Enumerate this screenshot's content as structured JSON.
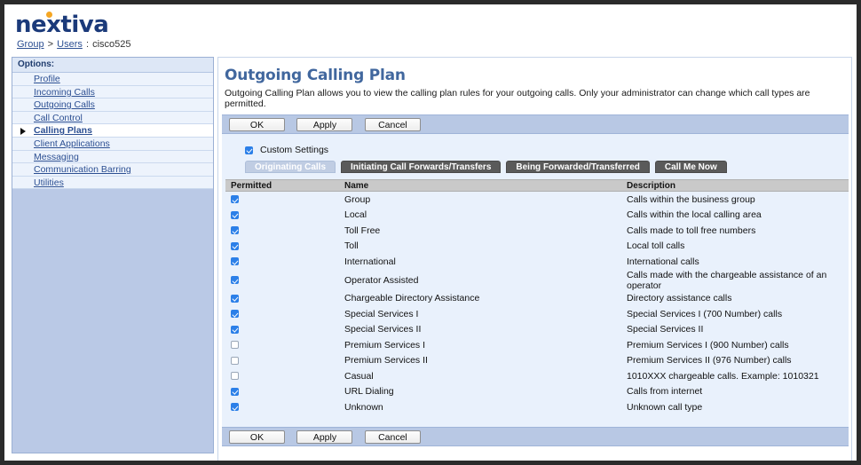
{
  "brand": {
    "logo_text": "nextiva",
    "logo_color": "#1b3a7a",
    "logo_dot_color": "#f5a623"
  },
  "breadcrumb": {
    "group_label": "Group",
    "separator": ">",
    "users_label": "Users",
    "colon": ":",
    "current": "cisco525"
  },
  "sidebar": {
    "heading": "Options:",
    "items": [
      {
        "label": "Profile",
        "active": false
      },
      {
        "label": "Incoming Calls",
        "active": false
      },
      {
        "label": "Outgoing Calls",
        "active": false
      },
      {
        "label": "Call Control",
        "active": false
      },
      {
        "label": "Calling Plans",
        "active": true
      },
      {
        "label": "Client Applications",
        "active": false
      },
      {
        "label": "Messaging",
        "active": false
      },
      {
        "label": "Communication Barring",
        "active": false
      },
      {
        "label": "Utilities",
        "active": false
      }
    ]
  },
  "main": {
    "title": "Outgoing Calling Plan",
    "description": "Outgoing Calling Plan allows you to view the calling plan rules for your outgoing calls. Only your administrator can change which call types are permitted.",
    "buttons": {
      "ok": "OK",
      "apply": "Apply",
      "cancel": "Cancel"
    },
    "custom_settings": {
      "label": "Custom Settings",
      "checked": true
    },
    "tabs": [
      {
        "label": "Originating Calls",
        "active": true
      },
      {
        "label": "Initiating Call Forwards/Transfers",
        "active": false
      },
      {
        "label": "Being Forwarded/Transferred",
        "active": false
      },
      {
        "label": "Call Me Now",
        "active": false
      }
    ],
    "table": {
      "columns": [
        "Permitted",
        "Name",
        "Description"
      ],
      "rows": [
        {
          "permitted": true,
          "name": "Group",
          "description": "Calls within the business group"
        },
        {
          "permitted": true,
          "name": "Local",
          "description": "Calls within the local calling area"
        },
        {
          "permitted": true,
          "name": "Toll Free",
          "description": "Calls made to toll free numbers"
        },
        {
          "permitted": true,
          "name": "Toll",
          "description": "Local toll calls"
        },
        {
          "permitted": true,
          "name": "International",
          "description": "International calls"
        },
        {
          "permitted": true,
          "name": "Operator Assisted",
          "description": "Calls made with the chargeable assistance of an operator"
        },
        {
          "permitted": true,
          "name": "Chargeable Directory Assistance",
          "description": "Directory assistance calls"
        },
        {
          "permitted": true,
          "name": "Special Services I",
          "description": "Special Services I (700 Number) calls"
        },
        {
          "permitted": true,
          "name": "Special Services II",
          "description": "Special Services II"
        },
        {
          "permitted": false,
          "name": "Premium Services I",
          "description": "Premium Services I (900 Number) calls"
        },
        {
          "permitted": false,
          "name": "Premium Services II",
          "description": "Premium Services II (976 Number) calls"
        },
        {
          "permitted": false,
          "name": "Casual",
          "description": "1010XXX chargeable calls. Example: 1010321"
        },
        {
          "permitted": true,
          "name": "URL Dialing",
          "description": "Calls from internet"
        },
        {
          "permitted": true,
          "name": "Unknown",
          "description": "Unknown call type"
        }
      ]
    }
  },
  "colors": {
    "title": "#41679e",
    "link": "#2c4f92",
    "button_bar": "#b8c8e4",
    "sidebar_bg": "#bac9e6",
    "row_bg": "#e9f1fc",
    "header_gray": "#c9c9c9",
    "checkbox_on": "#2b7fe8",
    "tab_inactive": "#5a5a5a",
    "tab_active": "#c0cde3"
  }
}
